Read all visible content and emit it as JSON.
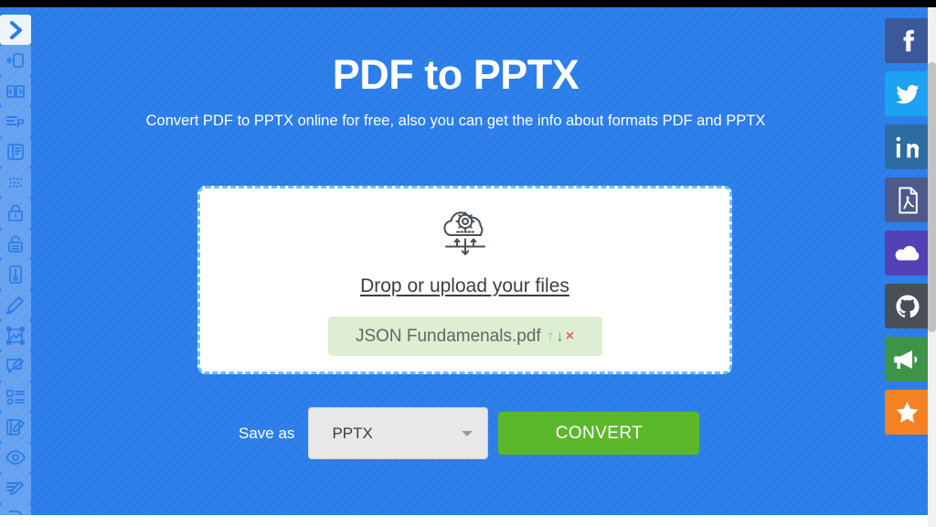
{
  "header": {
    "title": "PDF to PPTX",
    "subtitle": "Convert PDF to PPTX online for free, also you can get the info about formats PDF and PPTX"
  },
  "dropzone": {
    "icon": "cloud-gear-upload-icon",
    "label": "Drop or upload your files",
    "file": {
      "name": "JSON Fundamenals.pdf",
      "move_up": "↑",
      "move_down": "↓",
      "remove": "×",
      "up_color": "#8fd18a",
      "down_color": "#3ca83c",
      "remove_color": "#d96a6a",
      "chip_color": "#ddeed3"
    }
  },
  "controls": {
    "save_as_label": "Save as",
    "format_value": "PPTX",
    "format_options": [
      "PPTX"
    ],
    "convert_label": "CONVERT",
    "convert_color": "#5cb82b"
  },
  "theme": {
    "page_background": "#2b7de9",
    "dropzone_border": "#6fc0f5",
    "text_on_blue": "#ffffff"
  },
  "left_toolbar": {
    "items": [
      {
        "icon": "chevron-right-icon",
        "active": true
      },
      {
        "icon": "export-sign-out-icon",
        "active": false
      },
      {
        "icon": "split-book-icon",
        "active": false
      },
      {
        "icon": "convert-to-powerpoint-icon",
        "active": false
      },
      {
        "icon": "read-document-icon",
        "active": false
      },
      {
        "icon": "ocr-dots-icon",
        "active": false
      },
      {
        "icon": "lock-closed-icon",
        "active": false
      },
      {
        "icon": "lock-open-icon",
        "active": false
      },
      {
        "icon": "compress-file-icon",
        "active": false
      },
      {
        "icon": "edit-pencil-icon",
        "active": false
      },
      {
        "icon": "crop-image-icon",
        "active": false
      },
      {
        "icon": "annotate-comment-icon",
        "active": false
      },
      {
        "icon": "form-fill-icon",
        "active": false
      },
      {
        "icon": "sign-document-icon",
        "active": false
      },
      {
        "icon": "eye-view-icon",
        "active": false
      },
      {
        "icon": "edit-text-icon",
        "active": false
      },
      {
        "icon": "search-document-icon",
        "active": false
      }
    ]
  },
  "right_rail": {
    "items": [
      {
        "icon": "facebook-icon",
        "color": "#3b5998"
      },
      {
        "icon": "twitter-icon",
        "color": "#1da1f2"
      },
      {
        "icon": "linkedin-icon",
        "color": "#2d6ca2"
      },
      {
        "icon": "pdf-file-icon",
        "color": "#4e5a8c"
      },
      {
        "icon": "cloud-icon",
        "color": "#5441b5"
      },
      {
        "icon": "github-icon",
        "color": "#4a4f57"
      },
      {
        "icon": "megaphone-icon",
        "color": "#3d9447"
      },
      {
        "icon": "star-icon",
        "color": "#f58220"
      }
    ]
  }
}
